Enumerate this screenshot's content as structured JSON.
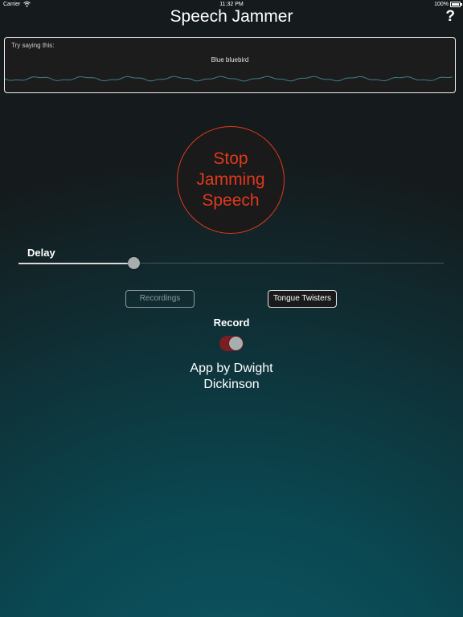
{
  "status_bar": {
    "carrier": "Carrier",
    "wifi_icon": "wifi-icon",
    "time": "11:32 PM",
    "battery_percent": "100%",
    "battery_icon": "battery-icon"
  },
  "header": {
    "title": "Speech Jammer",
    "help_label": "?"
  },
  "prompt": {
    "label": "Try saying this:",
    "text": "Blue bluebird"
  },
  "main": {
    "stop_button_label": "Stop\nJamming\nSpeech",
    "delay_label": "Delay",
    "delay_value_fraction": 0.27
  },
  "buttons": {
    "recordings": "Recordings",
    "tongue_twisters": "Tongue Twisters"
  },
  "record": {
    "label": "Record",
    "toggle_on": true
  },
  "credit": "App by Dwight\nDickinson",
  "colors": {
    "accent_red": "#e0391c",
    "toggle_on": "#7a1e22",
    "background_top": "#151a1c",
    "background_bottom": "#0d5764"
  }
}
